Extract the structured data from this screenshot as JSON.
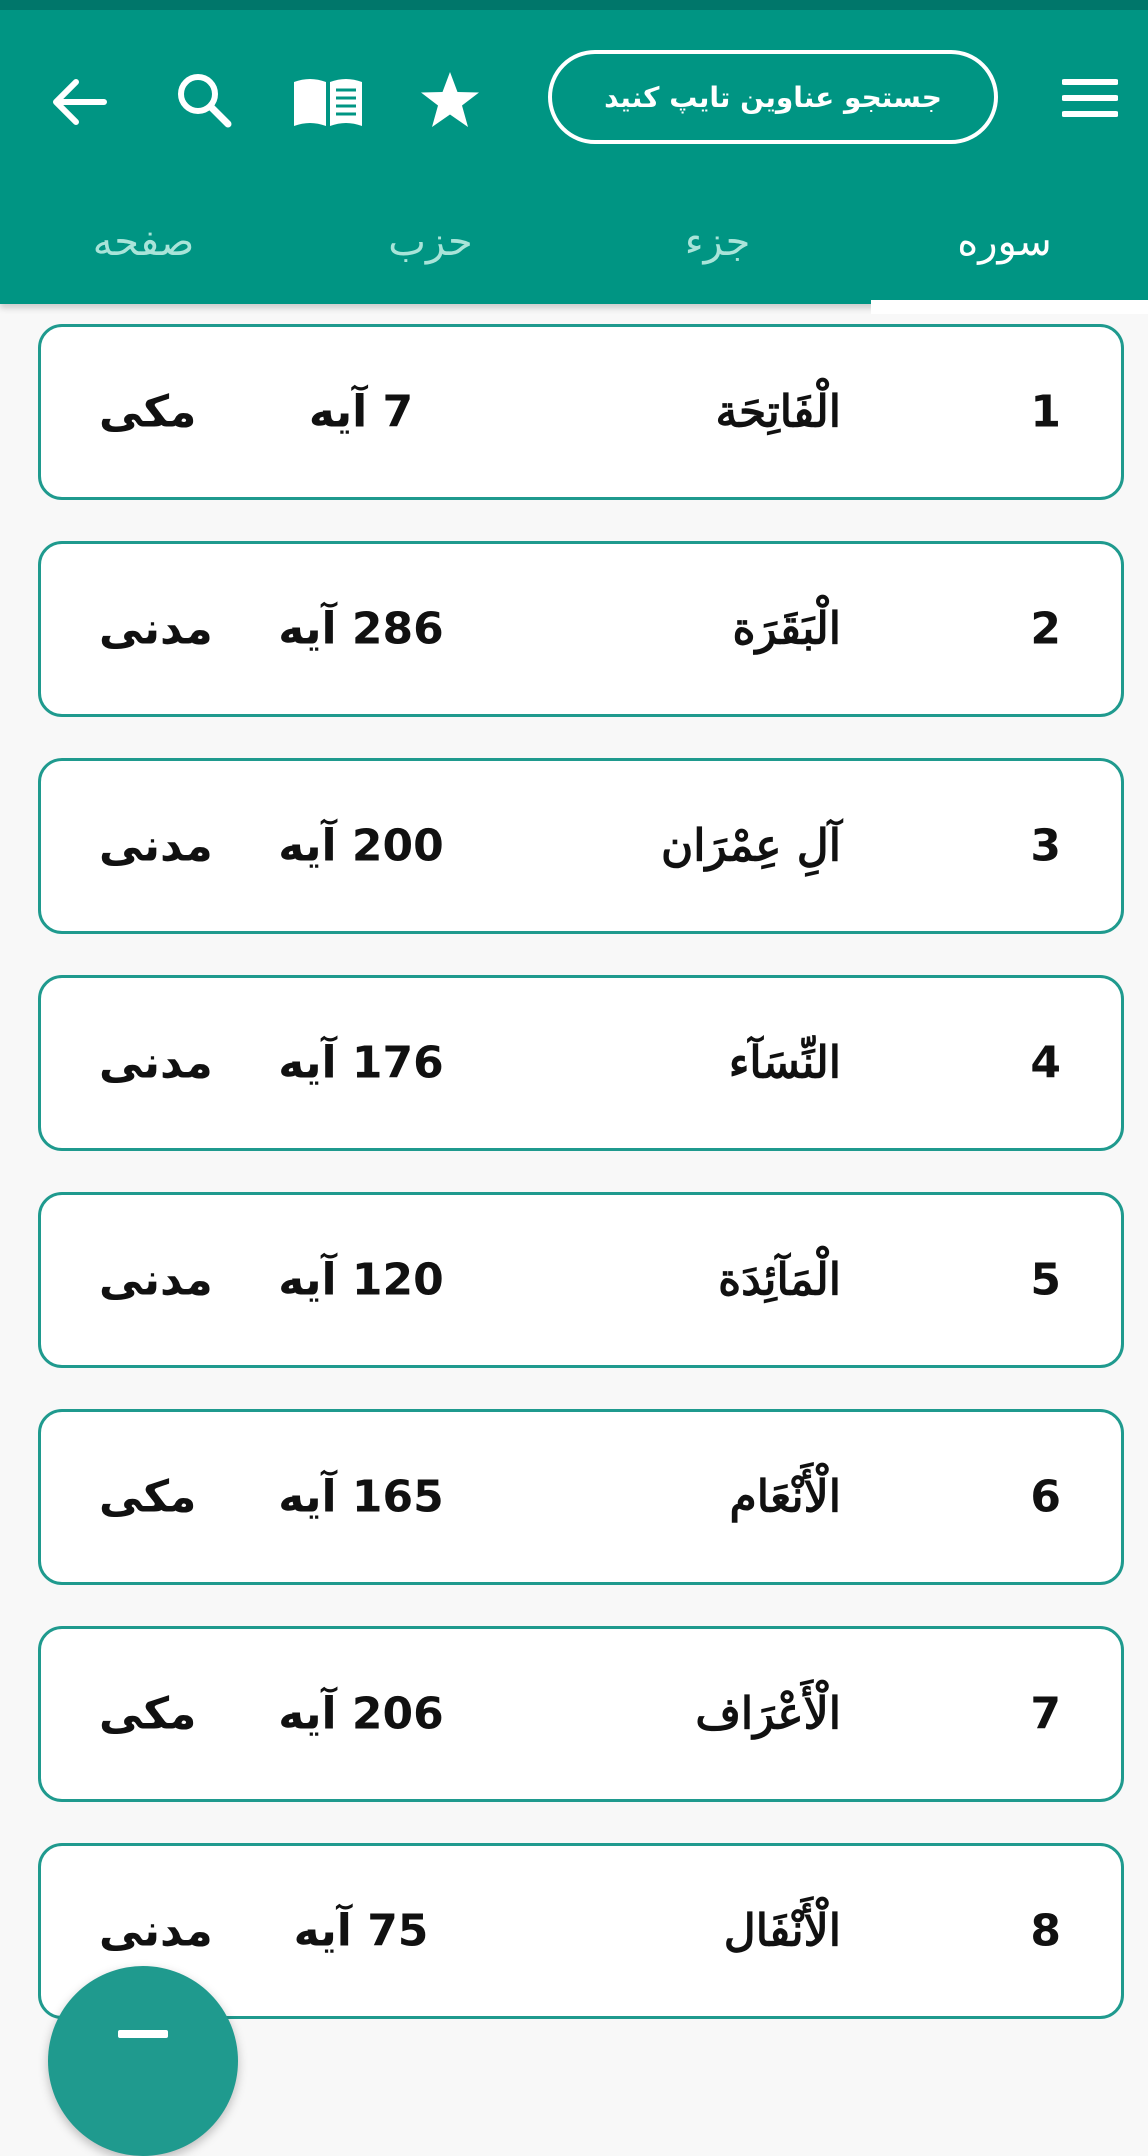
{
  "header": {
    "search_placeholder": "جستجو عناوین  تایپ کنید",
    "icons": [
      "menu-icon",
      "star-icon",
      "book-icon",
      "search-icon",
      "back-arrow-icon"
    ]
  },
  "tabs": [
    {
      "label": "سوره",
      "active": true
    },
    {
      "label": "جزء",
      "active": false
    },
    {
      "label": "حزب",
      "active": false
    },
    {
      "label": "صفحه",
      "active": false
    }
  ],
  "surahs": [
    {
      "number": "1",
      "name": "الْفَاتِحَة",
      "ayat": "7 آیه",
      "type": "مکی"
    },
    {
      "number": "2",
      "name": "الْبَقَرَة",
      "ayat": "286 آیه",
      "type": "مدنی"
    },
    {
      "number": "3",
      "name": "آلِ عِمْرَان",
      "ayat": "200 آیه",
      "type": "مدنی"
    },
    {
      "number": "4",
      "name": "النِّسَآء",
      "ayat": "176 آیه",
      "type": "مدنی"
    },
    {
      "number": "5",
      "name": "الْمَآئِدَة",
      "ayat": "120 آیه",
      "type": "مدنی"
    },
    {
      "number": "6",
      "name": "الْأَنْعَام",
      "ayat": "165 آیه",
      "type": "مکی"
    },
    {
      "number": "7",
      "name": "الْأَعْرَاف",
      "ayat": "206 آیه",
      "type": "مکی"
    },
    {
      "number": "8",
      "name": "الْأَنْفَال",
      "ayat": "75 آیه",
      "type": "مدنی"
    }
  ],
  "colors": {
    "primary": "#009583",
    "primary_dark": "#00766a",
    "card_border": "#1f9a8e",
    "inactive_tab": "#a9e4d9"
  }
}
